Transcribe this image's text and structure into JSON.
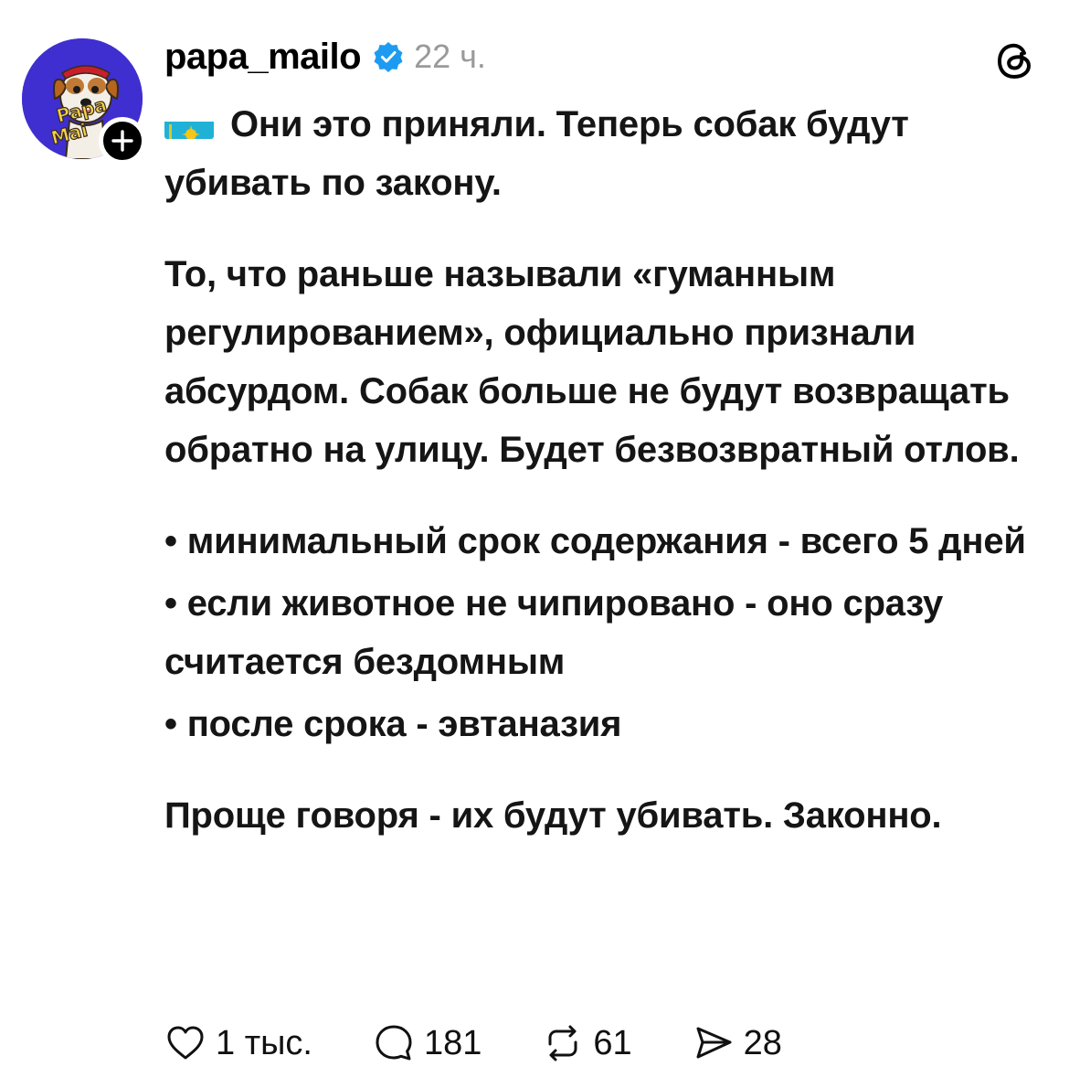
{
  "post": {
    "username": "papa_mailo",
    "timestamp": "22 ч.",
    "avatar_text": [
      "Papa",
      "Mai"
    ],
    "first_line": "Они это приняли. Теперь собак будут убивать по закону.",
    "paragraph2": "То, что раньше называли «гуманным регулированием», официально признали абсурдом. Собак больше не будут возвращать обратно на улицу. Будет безвозвратный отлов.",
    "bullets": [
      "• минимальный срок содержания - всего 5 дней",
      "• если животное не чипировано - оно сразу считается бездомным",
      "• после срока - эвтаназия"
    ],
    "closing": "Проще говоря - их будут убивать. Законно."
  },
  "actions": {
    "likes": "1 тыс.",
    "comments": "181",
    "reposts": "61",
    "shares": "28"
  },
  "colors": {
    "avatar_bg": "#3f2fd0",
    "verified": "#1d9bf0",
    "flag_bg": "#20b2d6",
    "flag_sun": "#f5c518",
    "timestamp": "#9a9a9a"
  },
  "icons": {
    "follow": "plus-icon",
    "verified": "verified-badge-icon",
    "logo": "threads-logo-icon",
    "like": "heart-icon",
    "comment": "comment-icon",
    "repost": "repost-icon",
    "share": "send-icon"
  }
}
